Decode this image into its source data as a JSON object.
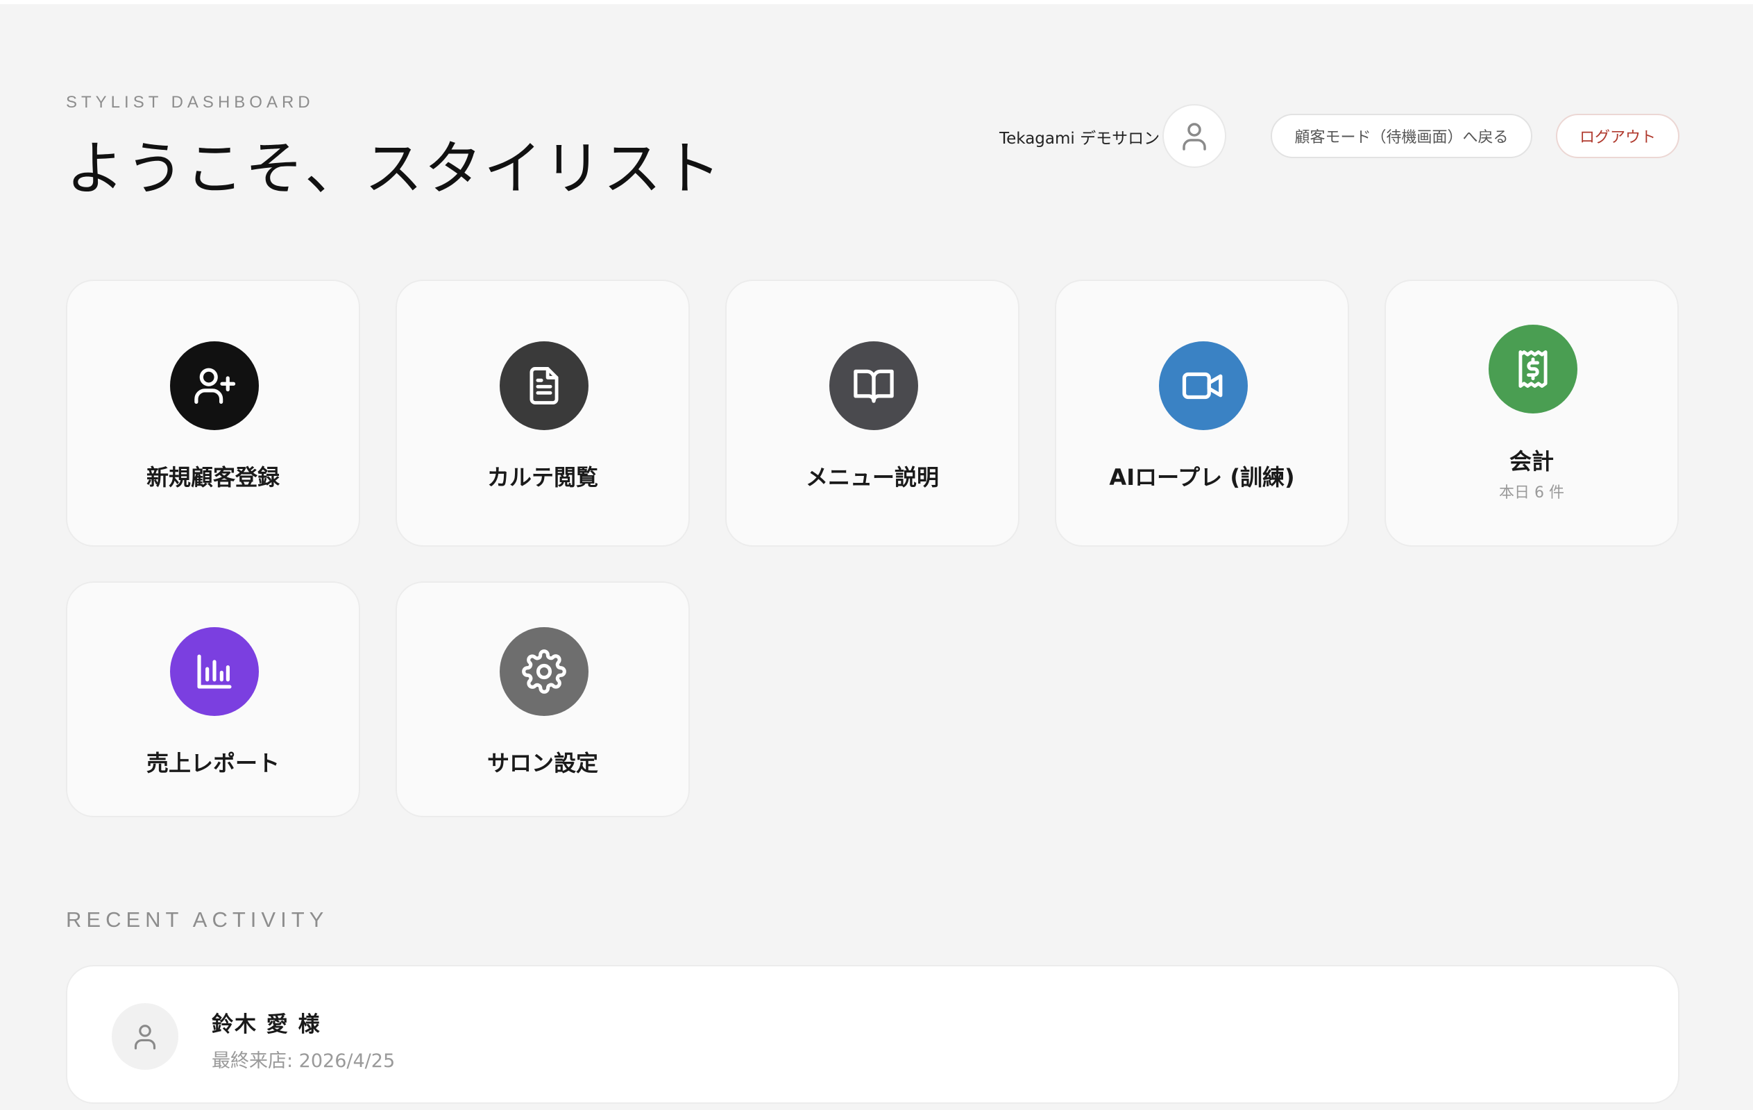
{
  "header": {
    "eyebrow": "STYLIST DASHBOARD",
    "title": "ようこそ、スタイリスト",
    "salon_name": "Tekagami デモサロン",
    "customer_mode_label": "顧客モード（待機画面）へ戻る",
    "logout_label": "ログアウト"
  },
  "tiles": [
    {
      "label": "新規顧客登録",
      "icon": "user-plus-icon",
      "color": "#111111"
    },
    {
      "label": "カルテ閲覧",
      "icon": "document-icon",
      "color": "#3a3a3a"
    },
    {
      "label": "メニュー説明",
      "icon": "open-book-icon",
      "color": "#4a4a4e"
    },
    {
      "label": "AIロープレ (訓練)",
      "icon": "video-camera-icon",
      "color": "#3a82c4"
    },
    {
      "label": "会計",
      "sub": "本日 6 件",
      "icon": "receipt-dollar-icon",
      "color": "#4a9e52"
    },
    {
      "label": "売上レポート",
      "icon": "bar-chart-icon",
      "color": "#7b3fe0"
    },
    {
      "label": "サロン設定",
      "icon": "gear-icon",
      "color": "#6e6e6e"
    }
  ],
  "recent": {
    "section_label": "RECENT ACTIVITY",
    "items": [
      {
        "name": "鈴木 愛 様",
        "last_visit": "最終来店: 2026/4/25"
      }
    ]
  }
}
